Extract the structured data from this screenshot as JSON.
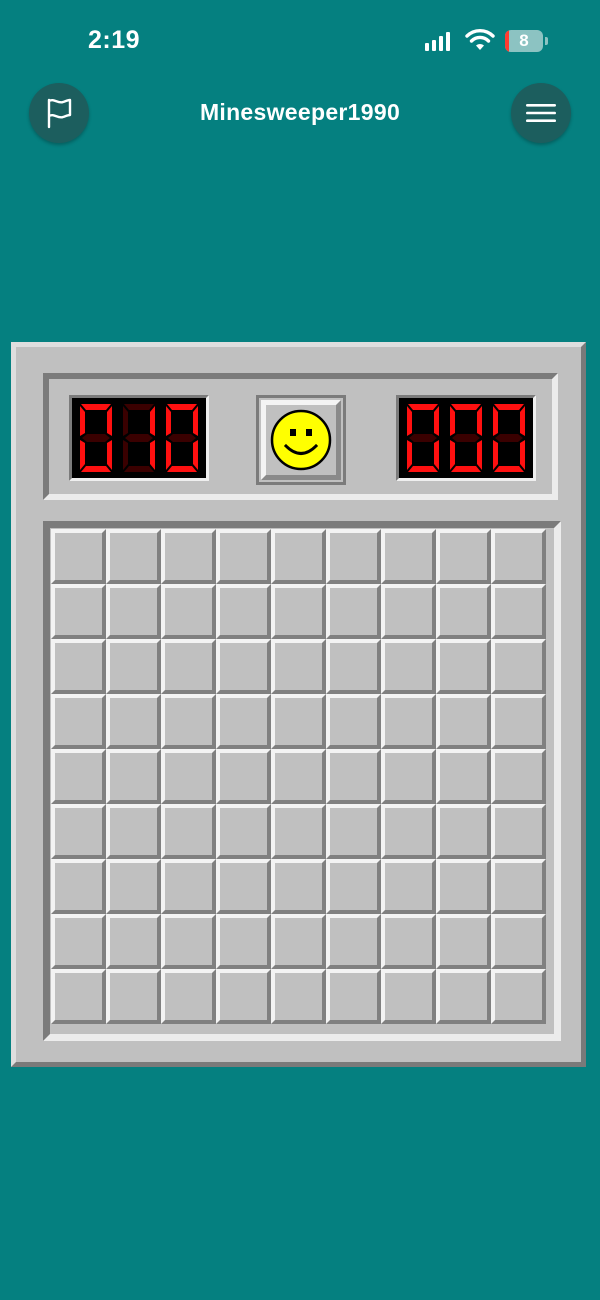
{
  "status_bar": {
    "time": "2:19",
    "battery_level": "8",
    "icons": [
      "cellular-signal-icon",
      "wifi-icon",
      "battery-icon"
    ]
  },
  "nav": {
    "title": "Minesweeper1990",
    "left_icon": "flag-icon",
    "right_icon": "hamburger-menu-icon"
  },
  "game": {
    "mine_counter": "010",
    "timer": "000",
    "face": "smiley-face-icon",
    "rows": 9,
    "columns": 9,
    "cell_state": "unrevealed"
  },
  "colors": {
    "background": "#058080",
    "nav_button": "#1c5e5e",
    "panel_gray": "#c0c0c0",
    "led_on": "#ff1010",
    "led_off": "#3a0000",
    "face_yellow": "#ffff00"
  }
}
